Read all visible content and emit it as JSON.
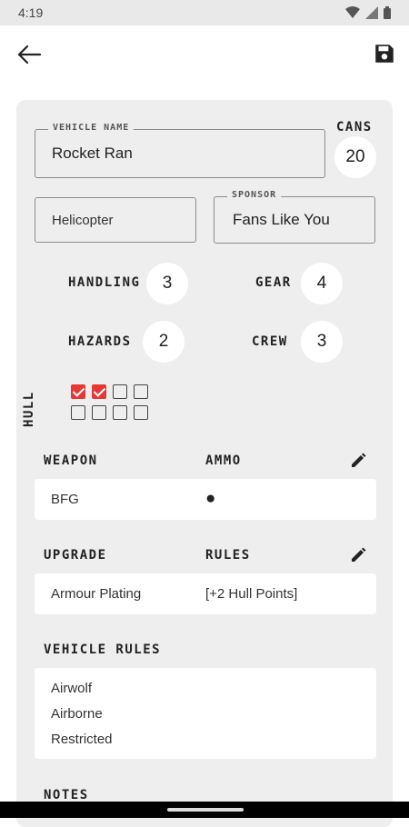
{
  "status": {
    "time": "4:19"
  },
  "vehicle": {
    "name_label": "VEHICLE NAME",
    "name": "Rocket Ran",
    "cans_label": "CANS",
    "cans": "20",
    "type": "Helicopter",
    "sponsor_label": "SPONSOR",
    "sponsor": "Fans Like You"
  },
  "stats": {
    "handling_label": "HANDLING",
    "handling": "3",
    "gear_label": "GEAR",
    "gear": "4",
    "hazards_label": "HAZARDS",
    "hazards": "2",
    "crew_label": "CREW",
    "crew": "3"
  },
  "hull": {
    "label": "HULL",
    "boxes": [
      true,
      true,
      false,
      false,
      false,
      false,
      false,
      false
    ],
    "check_color": "#e53935"
  },
  "weapons": {
    "header_weapon": "WEAPON",
    "header_ammo": "AMMO",
    "rows": [
      {
        "name": "BFG",
        "ammo": "●"
      }
    ]
  },
  "upgrades": {
    "header_upgrade": "UPGRADE",
    "header_rules": "RULES",
    "rows": [
      {
        "name": "Armour Plating",
        "rules": "[+2 Hull Points]"
      }
    ]
  },
  "vehicle_rules": {
    "header": "VEHICLE RULES",
    "items": [
      "Airwolf",
      "Airborne",
      "Restricted"
    ]
  },
  "notes": {
    "header": "NOTES"
  }
}
